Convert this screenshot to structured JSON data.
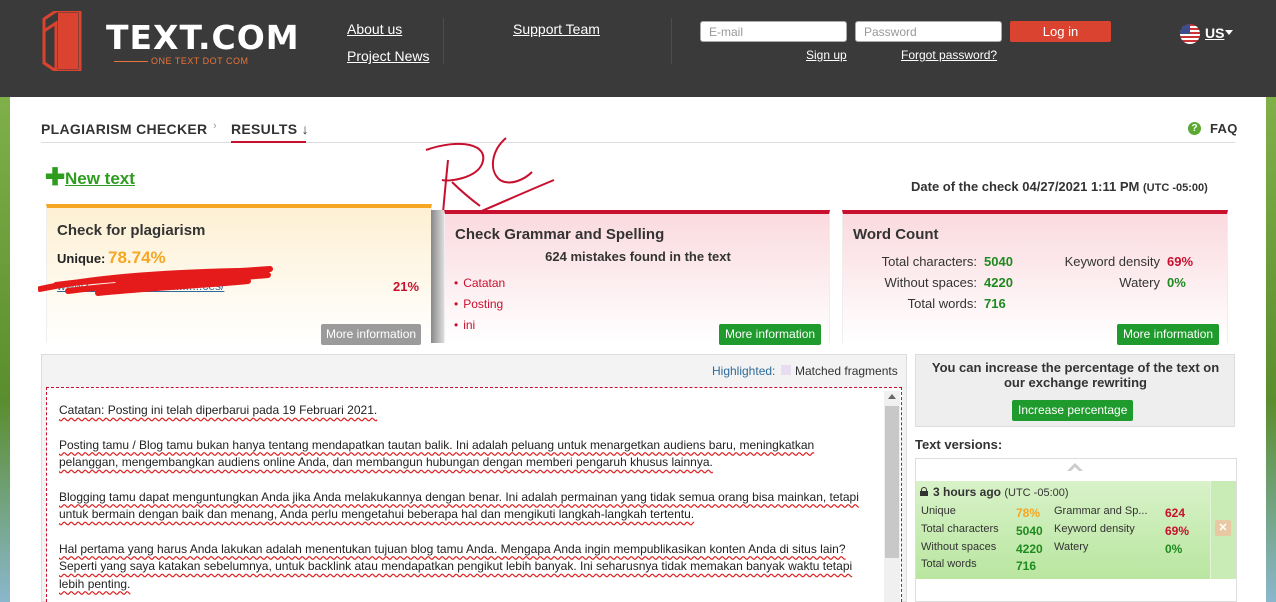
{
  "header": {
    "brand": "TEXT.COM",
    "tagline": "ONE TEXT DOT COM",
    "nav": {
      "about": "About us",
      "news": "Project News",
      "support": "Support Team"
    },
    "login": {
      "email_placeholder": "E-mail",
      "password_placeholder": "Password",
      "login_label": "Log in",
      "signup_label": "Sign up",
      "forgot_label": "Forgot password?"
    },
    "language": "US"
  },
  "breadcrumb": {
    "step1": "PLAGIARISM CHECKER",
    "step2": "RESULTS ↓",
    "faq": "FAQ",
    "faq_icon": "?"
  },
  "new_text": {
    "plus": "✚",
    "label": "New text"
  },
  "check_date": {
    "label": "Date of the check",
    "value": "04/27/2021 1:11 PM",
    "tz": "(UTC -05:00)"
  },
  "plagiarism_card": {
    "title": "Check for plagiarism",
    "unique_label": "Unique:",
    "unique_value": "78.74%",
    "source_url": "www.r..................................ces/",
    "source_percent": "21%",
    "more": "More information"
  },
  "grammar_card": {
    "title": "Check Grammar and Spelling",
    "summary": "624 mistakes found in the text",
    "mistakes": [
      "Catatan",
      "Posting",
      "ini"
    ],
    "more": "More information"
  },
  "wordcount_card": {
    "title": "Word Count",
    "total_chars_label": "Total characters:",
    "total_chars": "5040",
    "no_spaces_label": "Without spaces:",
    "no_spaces": "4220",
    "total_words_label": "Total words:",
    "total_words": "716",
    "keyword_label": "Keyword density",
    "keyword": "69%",
    "watery_label": "Watery",
    "watery": "0%",
    "more": "More information"
  },
  "text_panel": {
    "highlight_label": "Highlighted:",
    "highlight_legend": "Matched fragments",
    "paragraphs": [
      "Catatan: Posting ini telah diperbarui pada 19 Februari 2021.",
      "Posting tamu / Blog tamu bukan hanya tentang mendapatkan tautan balik. Ini adalah peluang untuk menargetkan audiens baru, meningkatkan pelanggan, mengembangkan audiens online Anda, dan membangun hubungan dengan memberi pengaruh khusus lainnya.",
      "Blogging tamu dapat menguntungkan Anda jika Anda melakukannya dengan benar. Ini adalah permainan yang tidak semua orang bisa mainkan, tetapi untuk bermain dengan baik dan menang, Anda perlu mengetahui beberapa hal dan mengikuti langkah-langkah tertentu.",
      "Hal pertama yang harus Anda lakukan adalah menentukan tujuan blog tamu Anda. Mengapa Anda ingin mempublikasikan konten Anda di situs lain? Seperti yang saya katakan sebelumnya, untuk backlink atau mendapatkan pengikut lebih banyak. Ini seharusnya tidak memakan banyak waktu tetapi lebih penting."
    ]
  },
  "promo": {
    "text": "You can increase the percentage of the text on our exchange rewriting",
    "button": "Increase percentage"
  },
  "versions": {
    "title": "Text versions:",
    "item": {
      "time": "3 hours ago",
      "tz": "(UTC -05:00)",
      "unique_label": "Unique",
      "unique": "78%",
      "total_chars_label": "Total characters",
      "total_chars": "5040",
      "no_spaces_label": "Without spaces",
      "no_spaces": "4220",
      "words_label": "Total words",
      "words": "716",
      "grammar_label": "Grammar and Sp...",
      "grammar": "624",
      "keyword_label": "Keyword density",
      "keyword": "69%",
      "watery_label": "Watery",
      "watery": "0%",
      "close": "✕"
    }
  },
  "annotation": "RC"
}
